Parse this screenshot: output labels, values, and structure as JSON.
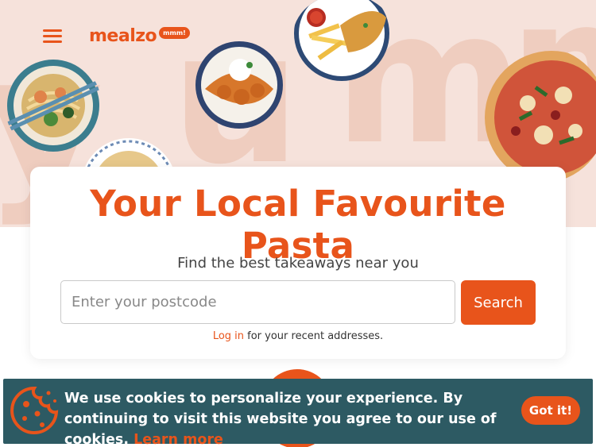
{
  "header": {
    "menu_icon": "hamburger-menu-icon",
    "logo_text": "mealzo",
    "logo_bubble": "mmm!"
  },
  "hero": {
    "background_word": "yumm"
  },
  "card": {
    "title": "Your Local Favourite Pasta",
    "subtitle": "Find the best takeaways near you",
    "postcode_placeholder": "Enter your postcode",
    "postcode_value": "",
    "search_label": "Search",
    "login_link": "Log in",
    "login_suffix": " for your recent addresses."
  },
  "cookie_banner": {
    "message": "We use cookies to personalize your experience. By continuing to visit this website you agree to our use of cookies. ",
    "learn_more": "Learn more",
    "accept_label": "Got it!",
    "icon": "cookie-icon"
  },
  "colors": {
    "accent": "#e8541b",
    "hero_bg": "#f6e2db",
    "cookie_bg": "#2d5a63"
  }
}
